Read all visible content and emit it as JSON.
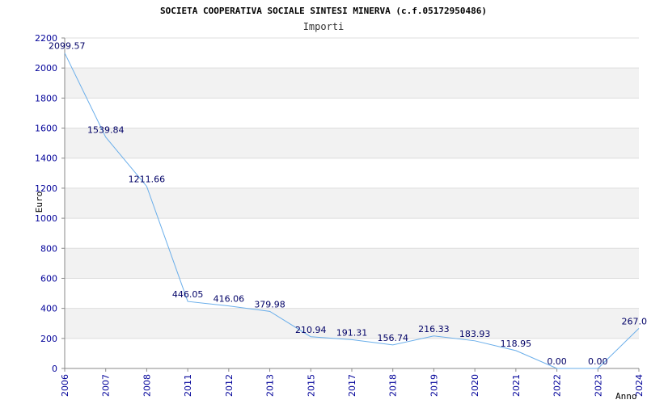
{
  "chart_data": {
    "type": "line",
    "title": "SOCIETA COOPERATIVA SOCIALE SINTESI MINERVA (c.f.05172950486)",
    "subtitle": "Importi",
    "xlabel": "Anno",
    "ylabel": "Euro",
    "categories": [
      "2006",
      "2007",
      "2008",
      "2011",
      "2012",
      "2013",
      "2015",
      "2017",
      "2018",
      "2019",
      "2020",
      "2021",
      "2022",
      "2023",
      "2024"
    ],
    "values": [
      2099.57,
      1539.84,
      1211.66,
      446.05,
      416.06,
      379.98,
      210.94,
      191.31,
      156.74,
      216.33,
      183.93,
      118.95,
      0.0,
      0.0,
      267.0
    ],
    "value_labels": [
      "2099.57",
      "1539.84",
      "1211.66",
      "446.05",
      "416.06",
      "379.98",
      "210.94",
      "191.31",
      "156.74",
      "216.33",
      "183.93",
      "118.95",
      "0.00",
      "0.00",
      "267.0"
    ],
    "yticks": [
      "0",
      "200",
      "400",
      "600",
      "800",
      "1000",
      "1200",
      "1400",
      "1600",
      "1800",
      "2000",
      "2200"
    ],
    "ylim": [
      0,
      2200
    ],
    "grid": true,
    "legend": "none",
    "colors": {
      "line": "#6aaeea",
      "axis_text": "#000099",
      "label_text": "#000066",
      "band": "#f2f2f2",
      "gridline": "#dddddd"
    }
  }
}
